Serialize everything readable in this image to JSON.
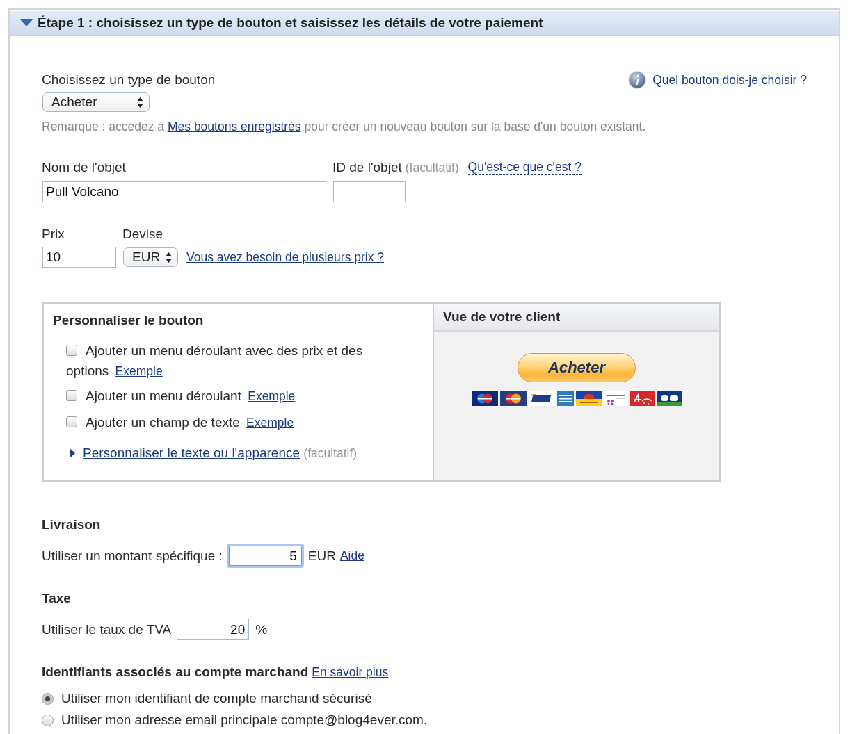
{
  "section": {
    "title": "Étape 1 : choisissez un type de bouton et saisissez les détails de votre paiement",
    "expanded": true
  },
  "button_type": {
    "label": "Choisissez un type de bouton",
    "value": "Acheter",
    "help_link": "Quel bouton dois-je choisir ?",
    "note": {
      "before": "Remarque : accédez à",
      "link": "Mes boutons enregistrés",
      "after": "pour créer un nouveau bouton sur la base d'un bouton existant."
    }
  },
  "item": {
    "name_label": "Nom de l'objet",
    "name_value": "Pull Volcano",
    "id_label": "ID de l'objet",
    "id_hint": "(facultatif)",
    "id_help_link": "Qu'est-ce que c'est ?"
  },
  "price": {
    "price_label": "Prix",
    "price_value": "10",
    "currency_label": "Devise",
    "currency_value": "EUR",
    "multi_price_link": "Vous avez besoin de plusieurs prix ?"
  },
  "customize": {
    "title": "Personnaliser le bouton",
    "options": [
      {
        "label": "Ajouter un menu déroulant avec des prix et des options",
        "link": "Exemple",
        "checked": false
      },
      {
        "label": "Ajouter un menu déroulant",
        "link": "Exemple",
        "checked": false
      },
      {
        "label": "Ajouter un champ de texte",
        "link": "Exemple",
        "checked": false
      }
    ],
    "appearance": {
      "link": "Personnaliser le texte ou l'apparence",
      "hint": "(facultatif)",
      "expanded": false
    }
  },
  "preview": {
    "title": "Vue de votre client",
    "button_label": "Acheter"
  },
  "shipping": {
    "title": "Livraison",
    "label": "Utiliser un montant spécifique :",
    "value": "5",
    "focused": true,
    "unit": "EUR",
    "help_link": "Aide"
  },
  "tax": {
    "title": "Taxe",
    "label": "Utiliser le taux de TVA",
    "value": "20",
    "unit": "%"
  },
  "merchant": {
    "title": "Identifiants associés au compte marchand",
    "link": "En savoir plus",
    "options": [
      {
        "label": "Utiliser mon identifiant de compte marchand sécurisé",
        "selected": true
      },
      {
        "label": "Utiliser mon adresse email principale compte@blog4ever.com.",
        "selected": false
      }
    ]
  }
}
